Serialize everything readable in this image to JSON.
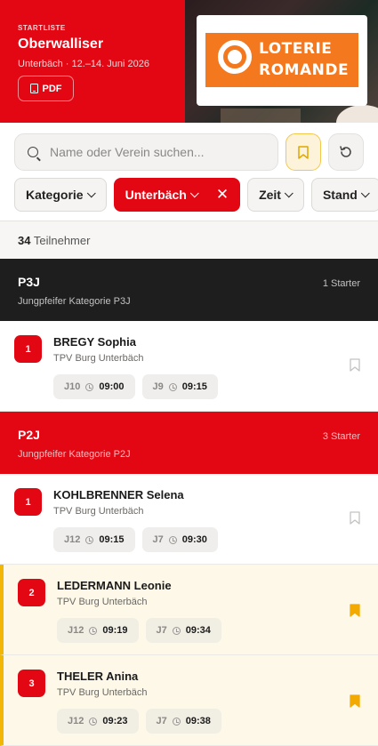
{
  "header": {
    "eyebrow": "STARTLISTE",
    "title": "Oberwalliser",
    "subtitle": "Unterbäch · 12.–14. Juni 2026",
    "pdf_label": "PDF",
    "logo_line1": "LOTERIE",
    "logo_line2": "ROMANDE"
  },
  "search": {
    "placeholder": "Name oder Verein suchen..."
  },
  "filters": {
    "kategorie": "Kategorie",
    "ort": "Unterbäch",
    "zeit": "Zeit",
    "stand": "Stand"
  },
  "participants": {
    "count": "34",
    "label": "Teilnehmer"
  },
  "colors": {
    "brand_red": "#e30613",
    "favorite_yellow": "#f2b705",
    "dark": "#1e1e1e"
  },
  "categories": [
    {
      "code": "P3J",
      "description": "Jungpfeifer Kategorie P3J",
      "count": "1 Starter",
      "entries": [
        {
          "rank": "1",
          "name": "BREGY Sophia",
          "club": "TPV Burg Unterbäch",
          "slots": [
            {
              "judge": "J10",
              "time": "09:00"
            },
            {
              "judge": "J9",
              "time": "09:15"
            }
          ],
          "bookmarked": false
        }
      ]
    },
    {
      "code": "P2J",
      "description": "Jungpfeifer Kategorie P2J",
      "count": "3 Starter",
      "entries": [
        {
          "rank": "1",
          "name": "KOHLBRENNER Selena",
          "club": "TPV Burg Unterbäch",
          "slots": [
            {
              "judge": "J12",
              "time": "09:15"
            },
            {
              "judge": "J7",
              "time": "09:30"
            }
          ],
          "bookmarked": false
        },
        {
          "rank": "2",
          "name": "LEDERMANN Leonie",
          "club": "TPV Burg Unterbäch",
          "slots": [
            {
              "judge": "J12",
              "time": "09:19"
            },
            {
              "judge": "J7",
              "time": "09:34"
            }
          ],
          "bookmarked": true
        },
        {
          "rank": "3",
          "name": "THELER Anina",
          "club": "TPV Burg Unterbäch",
          "slots": [
            {
              "judge": "J12",
              "time": "09:23"
            },
            {
              "judge": "J7",
              "time": "09:38"
            }
          ],
          "bookmarked": true
        }
      ]
    }
  ]
}
